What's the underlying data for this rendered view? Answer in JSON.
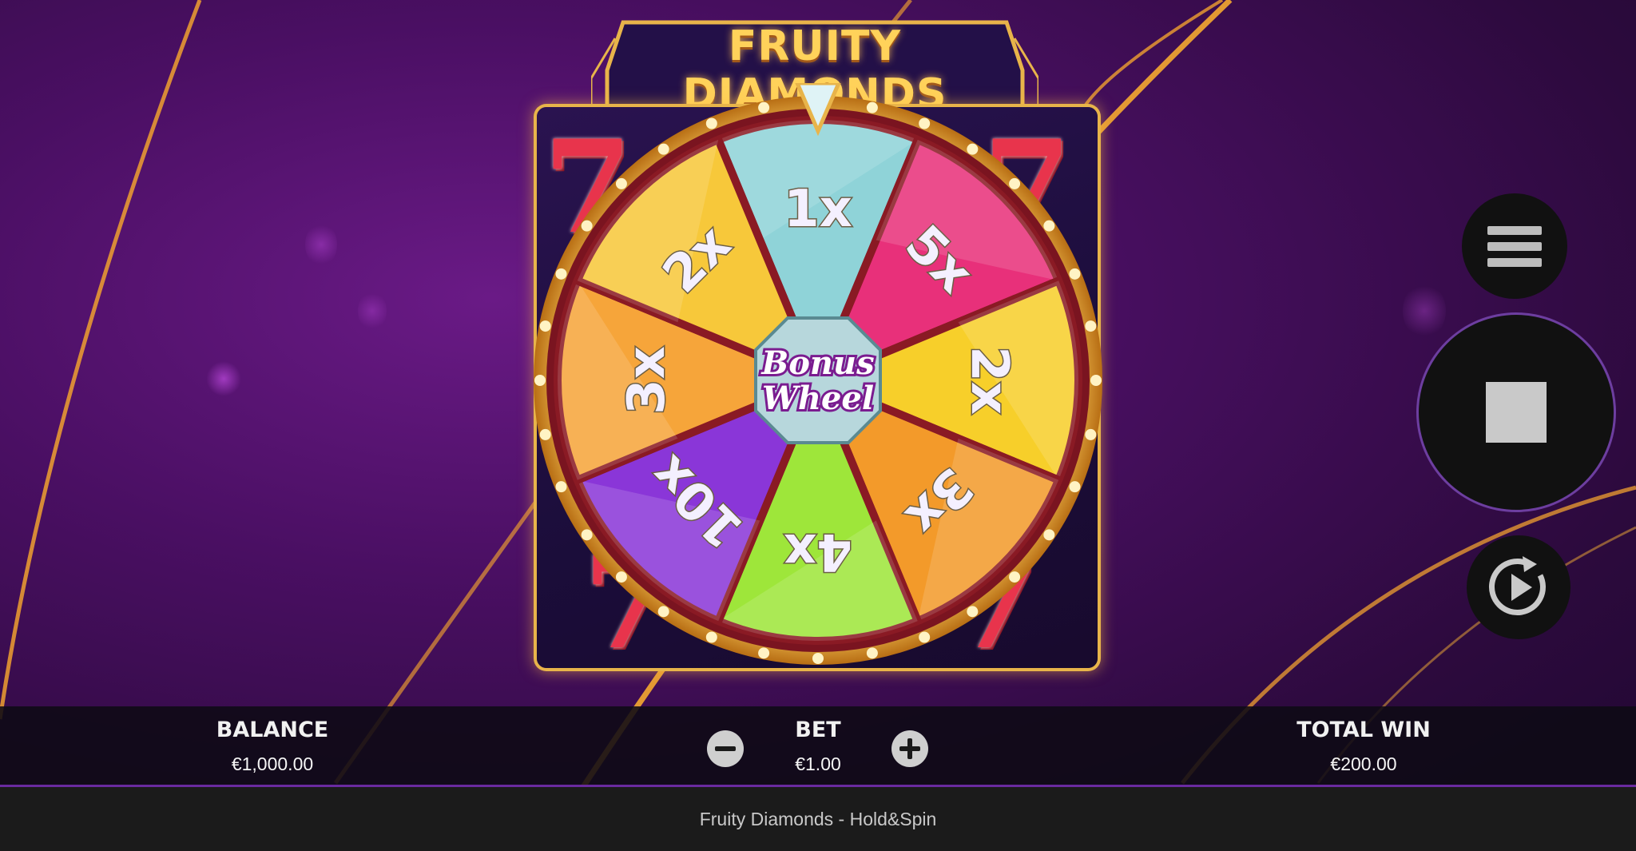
{
  "game": {
    "title": "FRUITY DIAMONDS",
    "subtitle": "Hold&Spin",
    "footer_title": "Fruity Diamonds - Hold&Spin"
  },
  "wheel": {
    "hub_line1": "Bonus",
    "hub_line2": "Wheel",
    "segments": [
      {
        "label": "1x",
        "color": "#8fd3d8"
      },
      {
        "label": "5x",
        "color": "#e8307a"
      },
      {
        "label": "2x",
        "color": "#f7cf2a"
      },
      {
        "label": "3x",
        "color": "#f39a2a"
      },
      {
        "label": "4x",
        "color": "#9ee63a"
      },
      {
        "label": "10x",
        "color": "#8a36d8"
      },
      {
        "label": "3x",
        "color": "#f6a53a"
      },
      {
        "label": "2x",
        "color": "#f7c83a"
      }
    ]
  },
  "controls": {
    "menu_icon": "hamburger-menu-icon",
    "stop_icon": "stop-icon",
    "autoplay_icon": "autoplay-icon"
  },
  "stats": {
    "balance_label": "BALANCE",
    "balance_value": "€1,000.00",
    "bet_label": "BET",
    "bet_value": "€1.00",
    "total_win_label": "TOTAL WIN",
    "total_win_value": "€200.00"
  },
  "colors": {
    "accent_gold": "#e8b44a",
    "background_purple": "#4a0f63",
    "bar_border": "#6a2aa0"
  }
}
